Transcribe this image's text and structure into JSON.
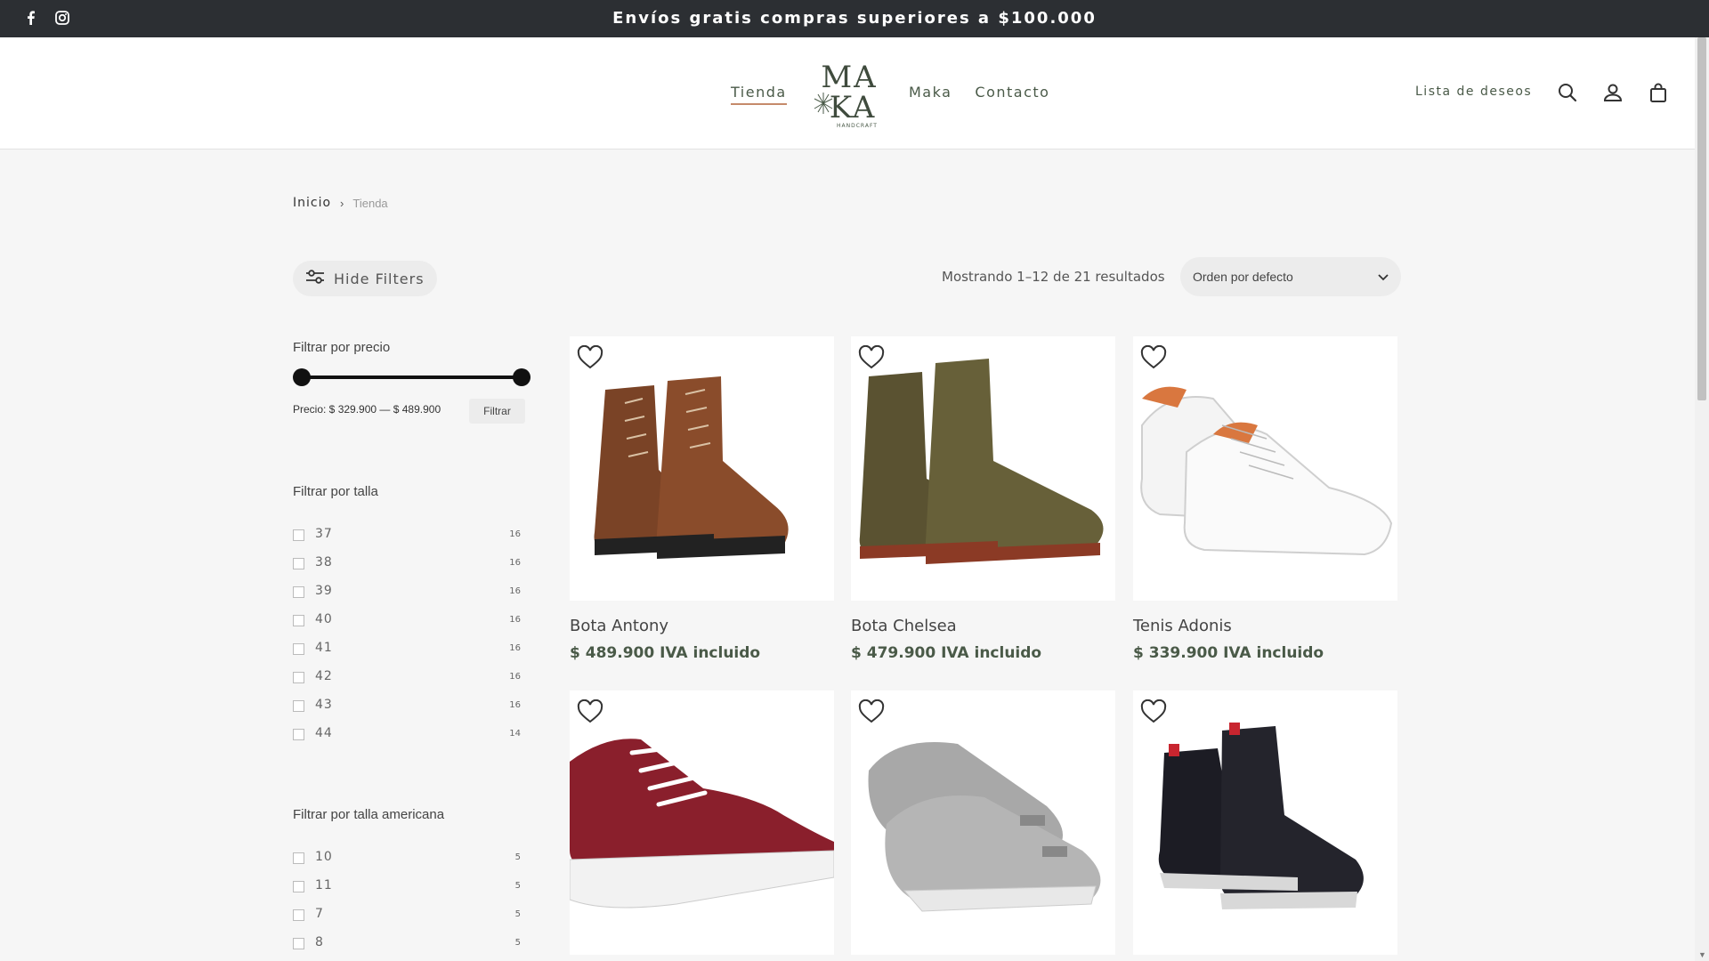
{
  "topbar": {
    "announcement": "Envíos gratis compras superiores a $100.000",
    "social": [
      "facebook-icon",
      "instagram-icon"
    ]
  },
  "header": {
    "nav_left": [
      {
        "label": "Tienda",
        "active": true
      }
    ],
    "logo": {
      "line1": "MA",
      "line2": "KA",
      "tagline": "HANDCRAFT"
    },
    "nav_right": [
      {
        "label": "Maka"
      },
      {
        "label": "Contacto"
      }
    ],
    "wishlist": "Lista de deseos",
    "icons": [
      "search-icon",
      "account-icon",
      "bag-icon"
    ]
  },
  "breadcrumb": {
    "home": "Inicio",
    "separator": "›",
    "current": "Tienda"
  },
  "toolbar": {
    "hide_filters": "Hide Filters",
    "result_count": "Mostrando 1–12 de 21 resultados",
    "orderby": "Orden por defecto"
  },
  "sidebar": {
    "price": {
      "title": "Filtrar por precio",
      "label": "Precio: $ 329.900 — $ 489.900",
      "button": "Filtrar",
      "min": 329900,
      "max": 489900
    },
    "size": {
      "title": "Filtrar por talla",
      "items": [
        {
          "value": "37",
          "count": "16"
        },
        {
          "value": "38",
          "count": "16"
        },
        {
          "value": "39",
          "count": "16"
        },
        {
          "value": "40",
          "count": "16"
        },
        {
          "value": "41",
          "count": "16"
        },
        {
          "value": "42",
          "count": "16"
        },
        {
          "value": "43",
          "count": "16"
        },
        {
          "value": "44",
          "count": "14"
        }
      ]
    },
    "us_size": {
      "title": "Filtrar por talla americana",
      "items": [
        {
          "value": "10",
          "count": "5"
        },
        {
          "value": "11",
          "count": "5"
        },
        {
          "value": "7",
          "count": "5"
        },
        {
          "value": "8",
          "count": "5"
        }
      ]
    }
  },
  "products": [
    {
      "name": "Bota Antony",
      "price": "$ 489.900 IVA incluido",
      "color": "#6b3a22"
    },
    {
      "name": "Bota Chelsea",
      "price": "$ 479.900 IVA incluido",
      "color": "#5a5231"
    },
    {
      "name": "Tenis Adonis",
      "price": "$ 339.900 IVA incluido",
      "color": "#f2f2f2"
    },
    {
      "name": "",
      "price": "",
      "color": "#8a1f2c"
    },
    {
      "name": "",
      "price": "",
      "color": "#a8a8a8"
    },
    {
      "name": "",
      "price": "",
      "color": "#1c1c24"
    }
  ],
  "colors": {
    "accent": "#c58a6b",
    "brand_green": "#4a5a48",
    "topbar_bg": "#2c2f33"
  }
}
